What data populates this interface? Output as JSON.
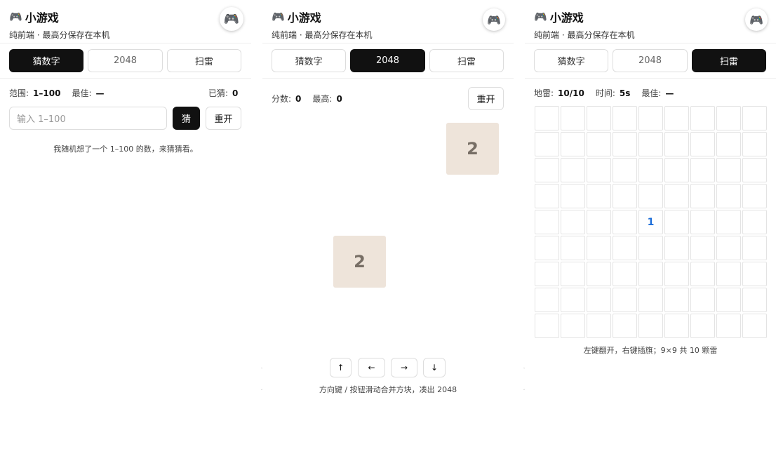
{
  "app": {
    "title": "小游戏",
    "subtitle": "纯前端 · 最高分保存在本机",
    "title_icon": "gamepad-icon",
    "fab_icon": "gamepad-icon"
  },
  "tabs": [
    "猜数字",
    "2048",
    "扫雷"
  ],
  "guess": {
    "range_label": "范围:",
    "range_value": "1–100",
    "best_label": "最佳:",
    "best_value": "—",
    "guessed_label": "已猜:",
    "guessed_value": "0",
    "input_placeholder": "输入 1–100",
    "guess_button": "猜",
    "restart_button": "重开",
    "hint": "我随机想了一个 1–100 的数，来猜猜看。"
  },
  "game2048": {
    "score_label": "分数:",
    "score_value": "0",
    "high_label": "最高:",
    "high_value": "0",
    "restart_button": "重开",
    "tiles": [
      "2",
      "2"
    ],
    "arrows": [
      "↑",
      "←",
      "→",
      "↓"
    ],
    "hint": "方向键 / 按钮滑动合并方块，凑出 2048"
  },
  "minesweeper": {
    "mines_label": "地雷:",
    "mines_value": "10/10",
    "time_label": "时间:",
    "time_value": "5s",
    "best_label": "最佳:",
    "best_value": "—",
    "revealed": [
      {
        "row": 4,
        "col": 4,
        "value": "1"
      }
    ],
    "hint": "左键翻开，右键插旗；9×9 共 10 颗雷"
  }
}
